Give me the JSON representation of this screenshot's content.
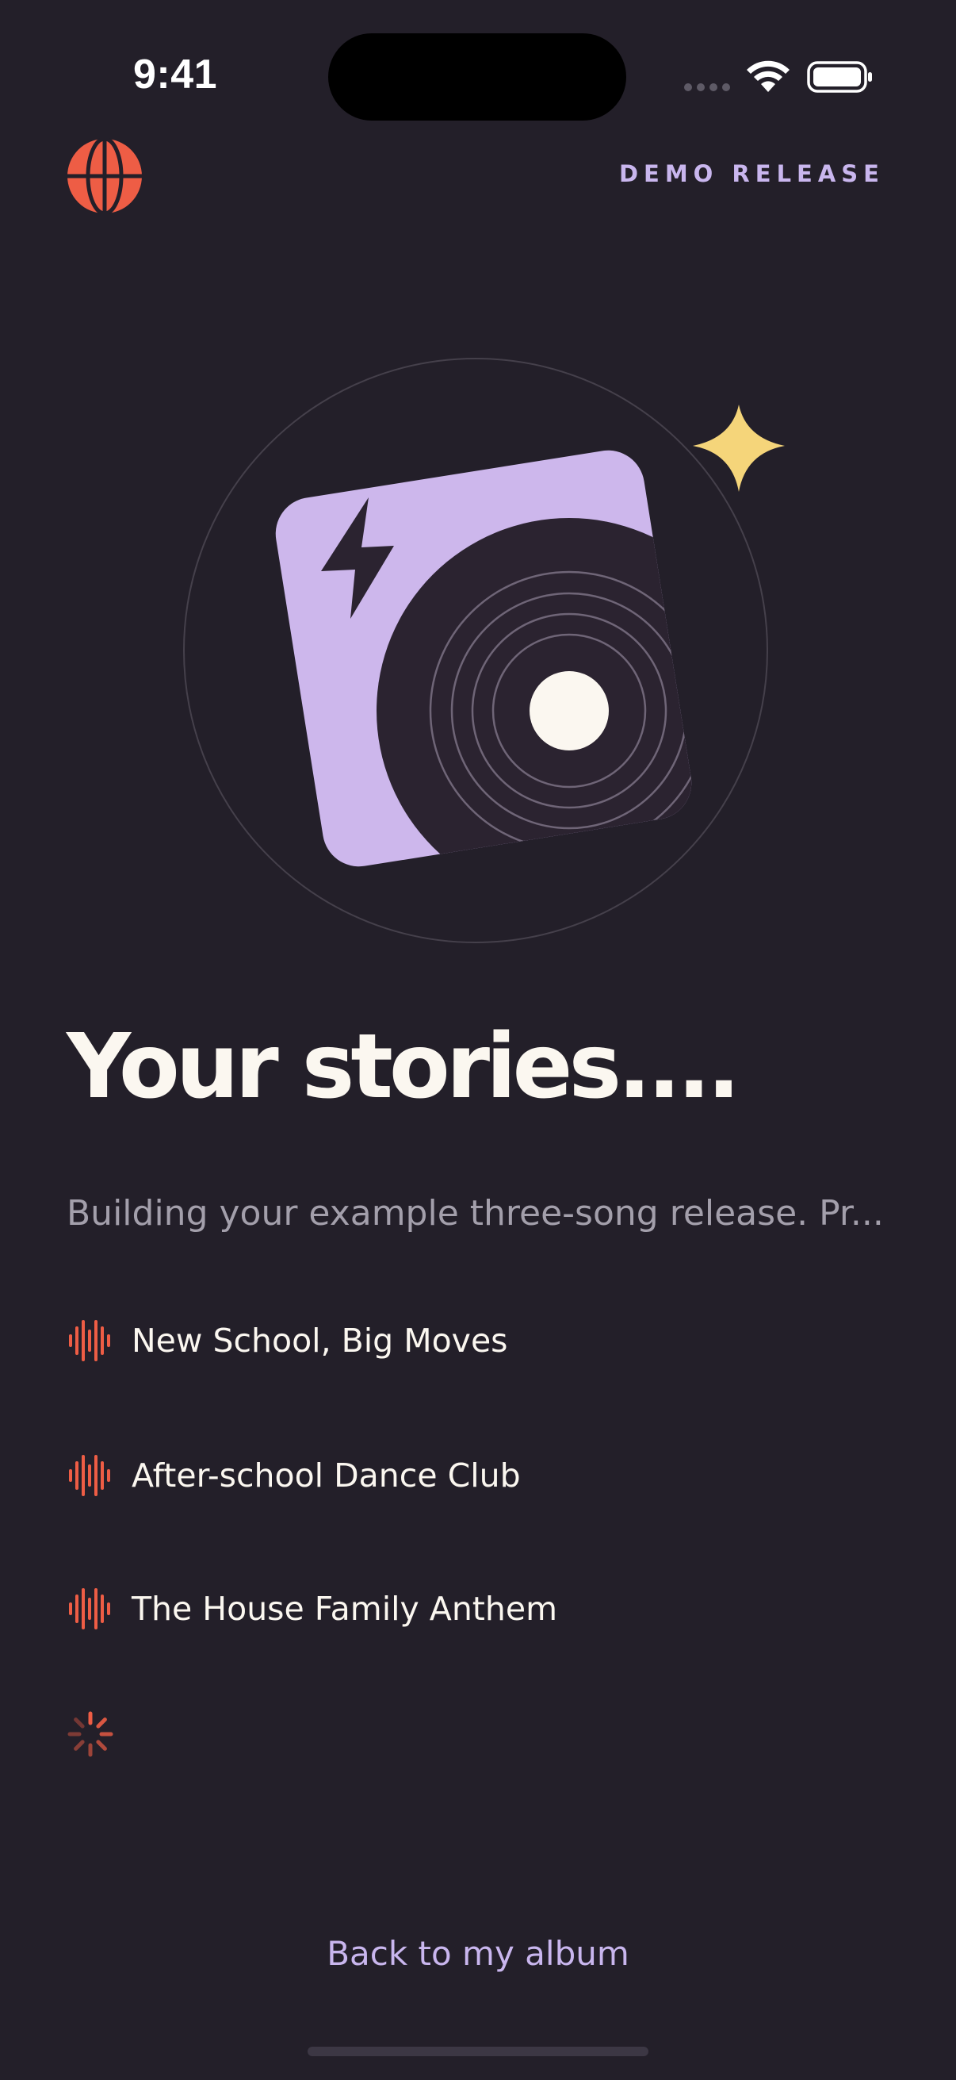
{
  "status_bar": {
    "time": "9:41",
    "icons": [
      "cellular-signal-icon",
      "wifi-icon",
      "battery-icon"
    ]
  },
  "header": {
    "logo_icon": "globe-icon",
    "badge_label": "DEMO RELEASE"
  },
  "hero": {
    "illustration": "album-cover-with-vinyl-record",
    "icons": [
      "lightning-bolt-icon",
      "sparkle-icon",
      "vinyl-record-icon"
    ]
  },
  "content": {
    "headline": "Your stories....",
    "subtitle": "Building your example three-song release. Pr..."
  },
  "tracks": [
    {
      "title": "New School, Big Moves",
      "status_icon": "audio-waveform-icon"
    },
    {
      "title": "After-school Dance Club",
      "status_icon": "audio-waveform-icon"
    },
    {
      "title": "The House Family Anthem",
      "status_icon": "audio-waveform-icon"
    }
  ],
  "loading": {
    "icon": "loading-spinner-icon"
  },
  "footer": {
    "back_label": "Back to my album"
  },
  "colors": {
    "background": "#231f29",
    "accent_coral": "#ee5d45",
    "accent_lavender": "#cdb7ec",
    "sparkle_yellow": "#f5d57a",
    "text_primary": "#fbf7f0",
    "text_muted": "#a39fab"
  }
}
